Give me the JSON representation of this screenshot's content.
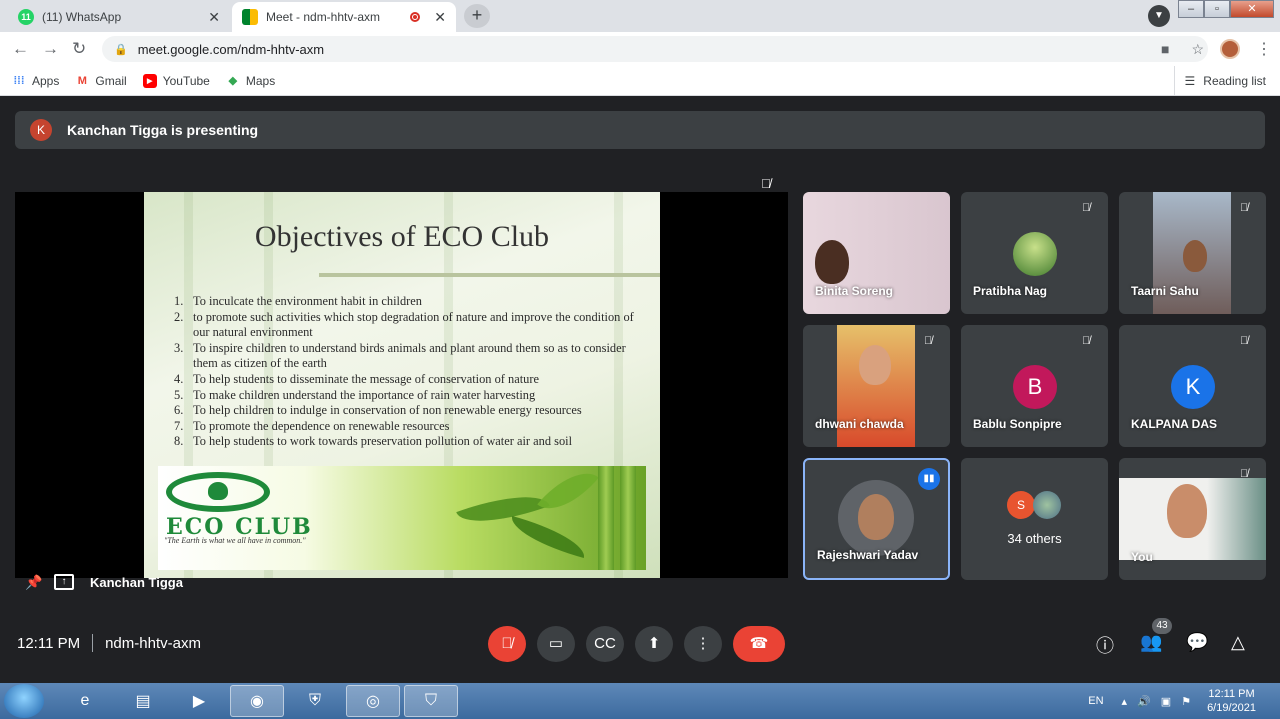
{
  "browser": {
    "tabs": [
      {
        "title": "(11) WhatsApp",
        "favicon_badge": "11",
        "active": false
      },
      {
        "title": "Meet - ndm-hhtv-axm",
        "active": true
      }
    ],
    "url": "meet.google.com/ndm-hhtv-axm",
    "bookmarks": [
      {
        "label": "Apps",
        "icon": "apps-grid-icon"
      },
      {
        "label": "Gmail",
        "icon": "gmail-icon"
      },
      {
        "label": "YouTube",
        "icon": "youtube-icon"
      },
      {
        "label": "Maps",
        "icon": "maps-icon"
      }
    ],
    "reading_list": "Reading list"
  },
  "meet": {
    "presenting_avatar": "K",
    "presenting_banner": "Kanchan Tigga is presenting",
    "presenter_name": "Kanchan Tigga",
    "slide": {
      "title": "Objectives of ECO Club",
      "items": [
        {
          "n": "1.",
          "text": "To inculcate the environment habit in children"
        },
        {
          "n": "2.",
          "text": "to promote such activities which stop degradation of nature and improve the condition of our natural environment"
        },
        {
          "n": "3.",
          "text": "To inspire children to understand birds animals and plant around them so as to consider them as citizen of the earth"
        },
        {
          "n": "4.",
          "text": "To help students to disseminate the message of conservation of nature"
        },
        {
          "n": "5.",
          "text": "To make children understand the importance of rain water harvesting"
        },
        {
          "n": "6.",
          "text": "To help children to indulge in conservation of non renewable energy resources"
        },
        {
          "n": "7.",
          "text": "To promote the dependence on renewable resources"
        },
        {
          "n": "8.",
          "text": "To help students to work towards preservation pollution of water air and soil"
        }
      ],
      "logo_text": "ECO CLUB",
      "logo_tagline": "\"The Earth is what we all have in common.\""
    },
    "participants": [
      {
        "name": "Binita Soreng",
        "muted": false
      },
      {
        "name": "Pratibha Nag",
        "muted": true
      },
      {
        "name": "Taarni Sahu",
        "muted": true
      },
      {
        "name": "dhwani chawda",
        "muted": true
      },
      {
        "name": "Bablu Sonpipre",
        "avatar": "B",
        "color": "#c2185b",
        "muted": true
      },
      {
        "name": "KALPANA DAS",
        "avatar": "K",
        "color": "#1a73e8",
        "muted": true
      },
      {
        "name": "Rajeshwari Yadav",
        "speaking": true
      },
      {
        "name": "34 others",
        "avatar": "S",
        "color": "#e8542f"
      },
      {
        "name": "You",
        "muted": true
      }
    ],
    "participant_count": "43",
    "time": "12:11 PM",
    "meeting_code": "ndm-hhtv-axm"
  },
  "taskbar": {
    "lang": "EN",
    "time": "12:11 PM",
    "date": "6/19/2021"
  }
}
